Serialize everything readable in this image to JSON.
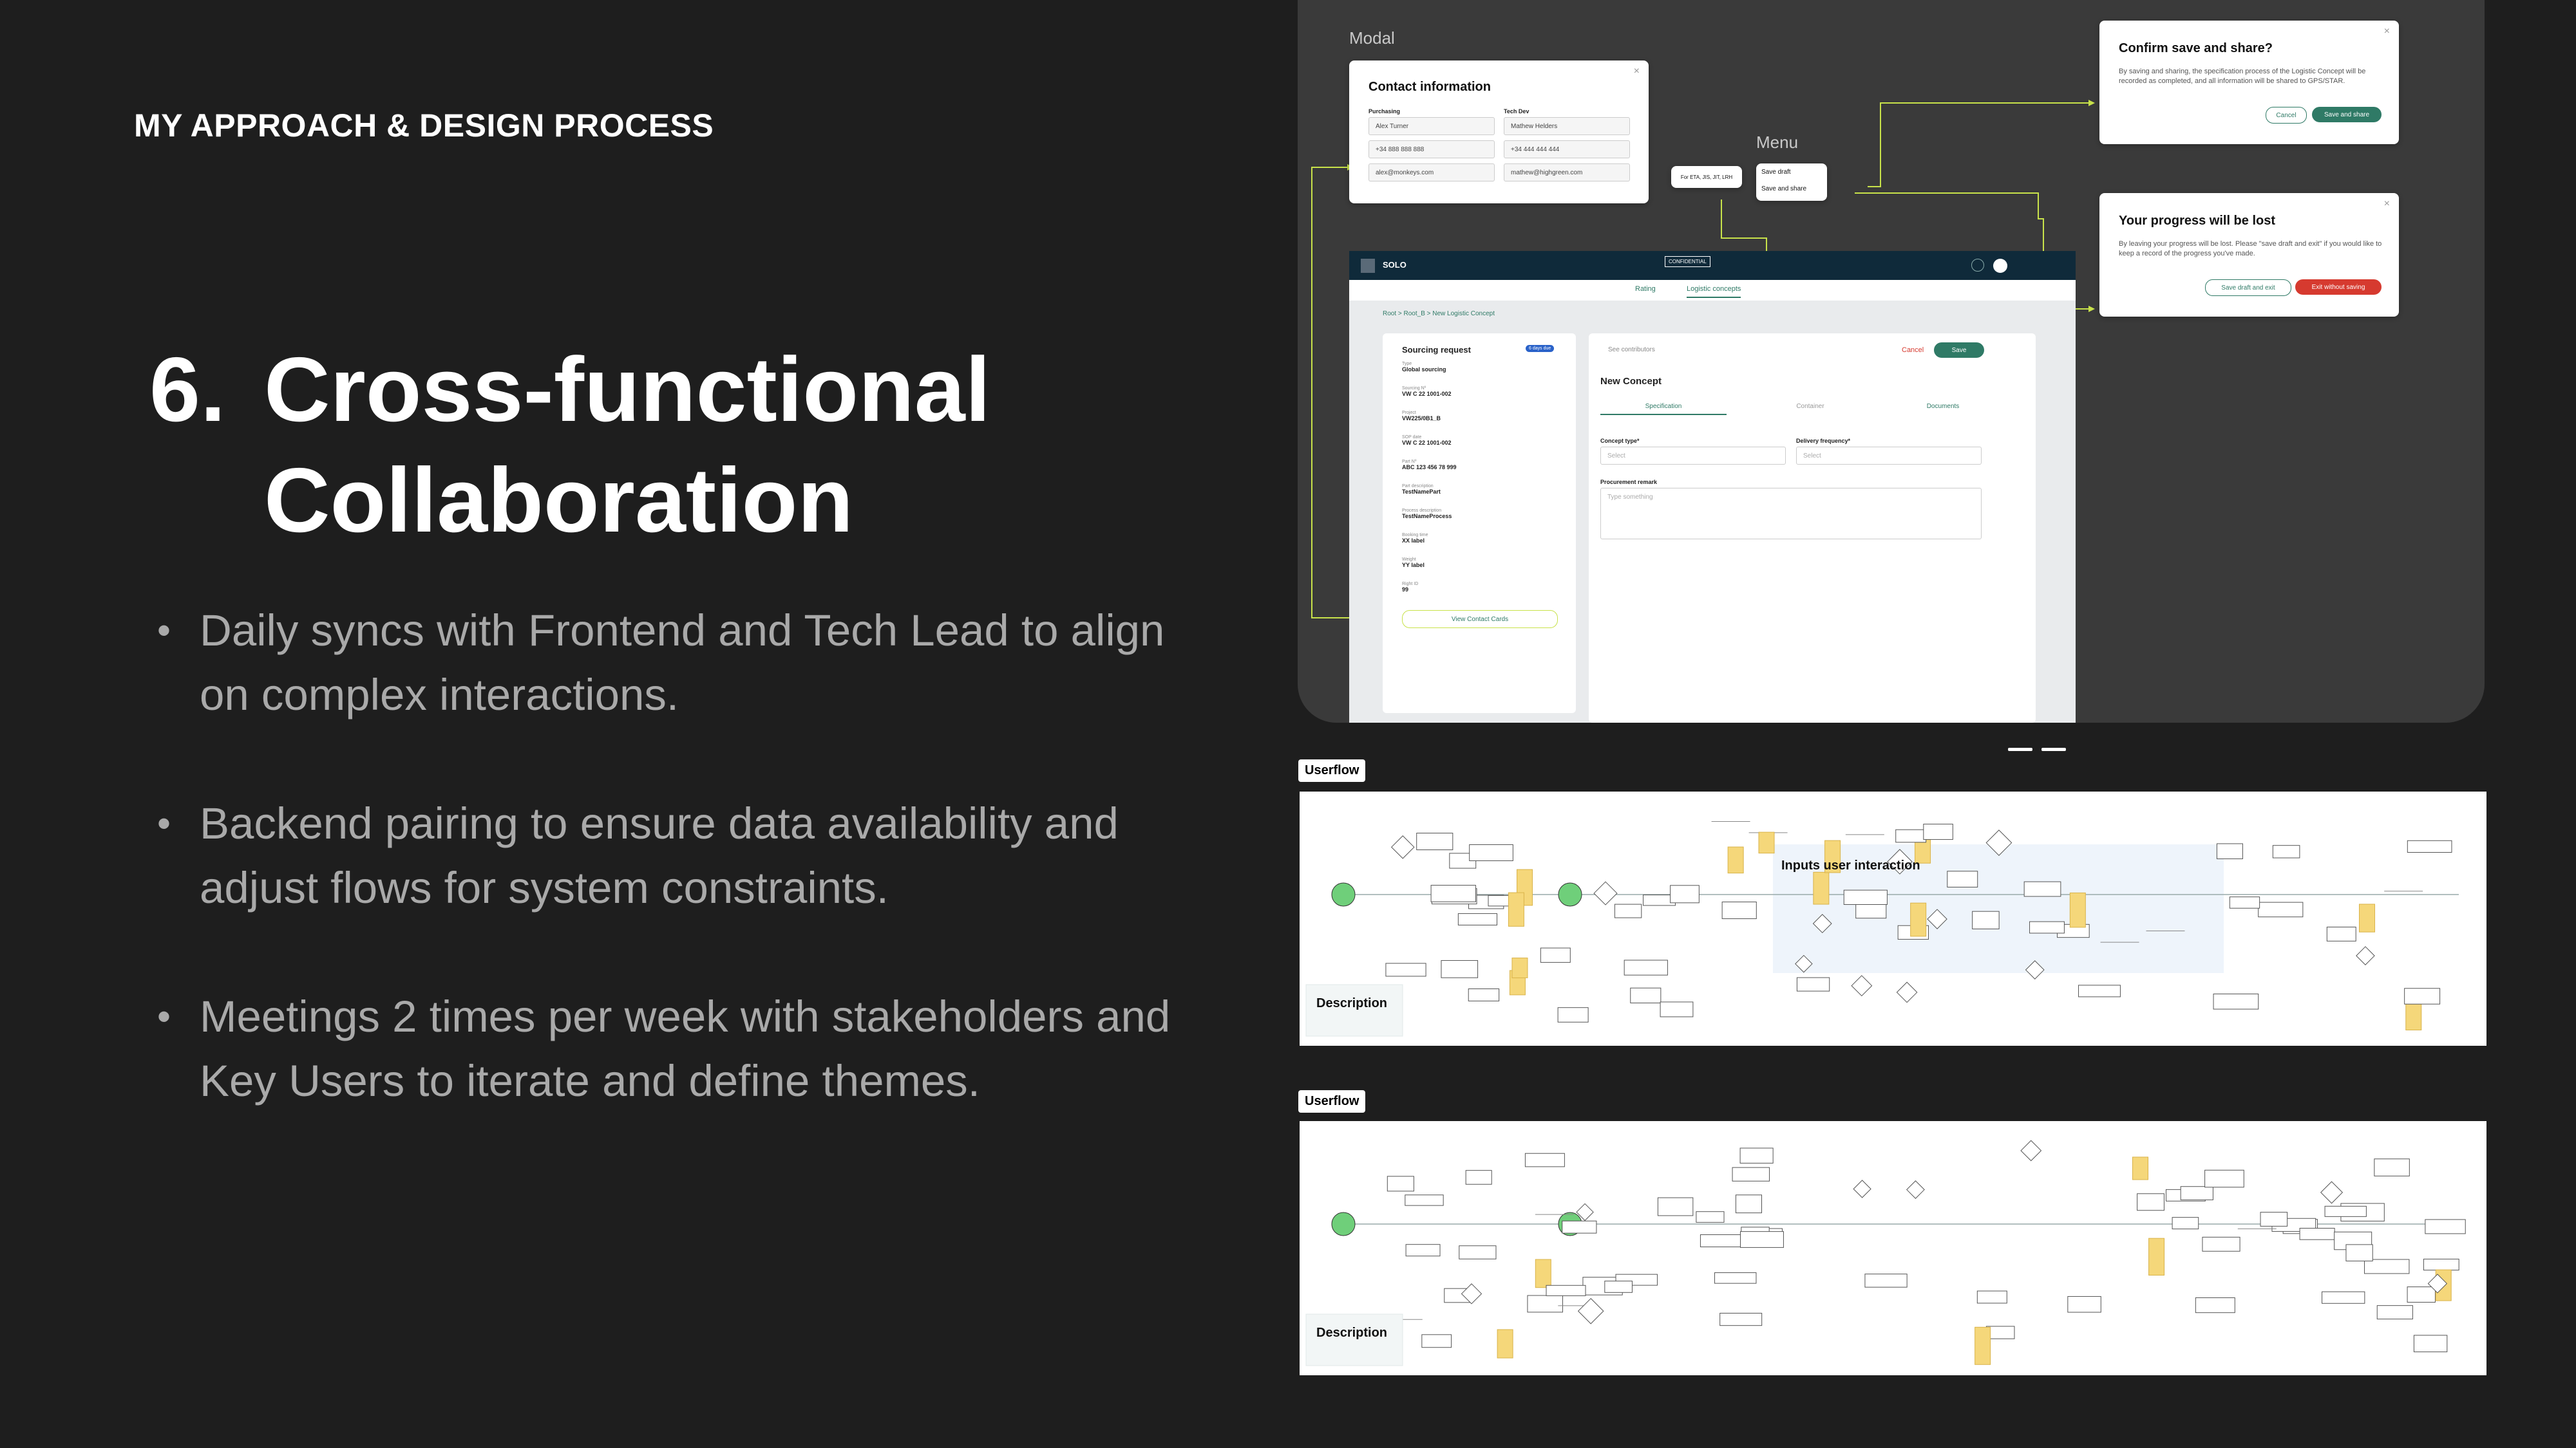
{
  "slide": {
    "section_label": "MY APPROACH & DESIGN PROCESS",
    "title_number": "6.",
    "title_line1": "Cross-functional",
    "title_line2": "Collaboration",
    "bullets": [
      "Daily syncs with Frontend and Tech Lead to align on complex interactions.",
      "Backend pairing to ensure data availability and adjust flows for system constraints.",
      "Meetings 2 times per week with stakeholders and Key Users to iterate and define themes."
    ]
  },
  "mockup": {
    "modal_label": "Modal",
    "menu_label": "Menu",
    "contact_card": {
      "title": "Contact information",
      "col1_label": "Purchasing",
      "col2_label": "Tech Dev",
      "col1": [
        "Alex Turner",
        "+34 888 888 888",
        "alex@monkeys.com"
      ],
      "col2": [
        "Mathew Helders",
        "+34 444 444 444",
        "mathew@highgreen.com"
      ]
    },
    "menu_items": [
      "Save draft",
      "Save and share"
    ],
    "tooltip": "For ETA, JIS, JIT, LRH",
    "confirm_dialog": {
      "title": "Confirm save and share?",
      "text": "By saving and sharing, the specification process of the Logistic Concept will be recorded as completed, and all information will be shared to GPS/STAR.",
      "cancel": "Cancel",
      "confirm": "Save and share"
    },
    "progress_dialog": {
      "title": "Your progress will be lost",
      "text": "By leaving your progress will be lost. Please \"save draft and exit\" if you would like to keep a record of the progress you've made.",
      "secondary": "Save draft and exit",
      "danger": "Exit without saving"
    },
    "app": {
      "brand": "SOLO",
      "badge": "CONFIDENTIAL",
      "nav": [
        "Rating",
        "Logistic concepts"
      ],
      "breadcrumb": "Root  >  Root_B  >  New Logistic Concept",
      "sourcing": {
        "title": "Sourcing request",
        "tag": "6 days due",
        "fields": [
          {
            "k": "Type",
            "v": "Global sourcing"
          },
          {
            "k": "Sourcing Nº",
            "v": "VW C 22 1001-002"
          },
          {
            "k": "Project",
            "v": "VW225/0B1_B"
          },
          {
            "k": "SOP date",
            "v": "VW C 22 1001-002"
          },
          {
            "k": "Part Nº",
            "v": "ABC 123 456 78 999"
          },
          {
            "k": "Part description",
            "v": "TestNamePart"
          },
          {
            "k": "Process description",
            "v": "TestNameProcess"
          },
          {
            "k": "Booking time",
            "v": "XX label"
          },
          {
            "k": "Weight",
            "v": "YY label"
          },
          {
            "k": "Right ID",
            "v": "99"
          }
        ],
        "contact_button": "View Contact Cards"
      },
      "concept": {
        "contributors": "See contributors",
        "cancel": "Cancel",
        "save": "Save",
        "title": "New Concept",
        "tabs": [
          "Specification",
          "Container",
          "Documents"
        ],
        "concept_type_label": "Concept type*",
        "delivery_label": "Delivery frequency*",
        "select_placeholder": "Select",
        "remark_label": "Procurement remark",
        "remark_placeholder": "Type something"
      }
    }
  },
  "userflows": [
    {
      "tag": "Userflow",
      "description": "Description",
      "note": "Inputs user interaction"
    },
    {
      "tag": "Userflow",
      "description": "Description"
    }
  ],
  "colors": {
    "background": "#1e1e1e",
    "panel": "#3a3a3a",
    "accent_green": "#2f7a66",
    "wire": "#c8e24a",
    "danger": "#d63a2f"
  }
}
